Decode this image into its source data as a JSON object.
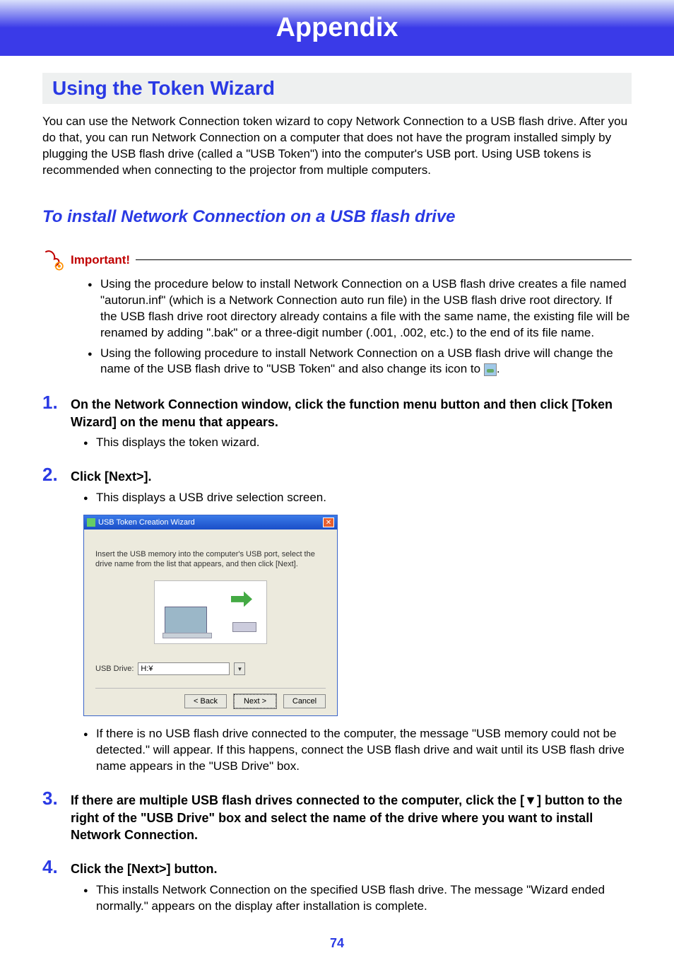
{
  "header": {
    "title": "Appendix"
  },
  "section": {
    "title": "Using the Token Wizard",
    "intro": "You can use the Network Connection token wizard to copy Network Connection to a USB flash drive. After you do that, you can run Network Connection on a computer that does not have the program installed simply by plugging the USB flash drive (called a \"USB Token\") into the computer's USB port. Using USB tokens is recommended when connecting to the projector from multiple computers."
  },
  "subsection": {
    "title": "To install Network Connection on a USB flash drive"
  },
  "important": {
    "label": "Important!",
    "items": [
      "Using the procedure below to install Network Connection on a USB flash drive creates a file named \"autorun.inf\" (which is a Network Connection auto run file) in the USB flash drive root directory. If the USB flash drive root directory already contains a file with the same name, the existing file will be renamed by adding \".bak\" or a three-digit number (.001, .002, etc.) to the end of its file name.",
      "Using the following procedure to install Network Connection on a USB flash drive will change the name of the USB flash drive to \"USB Token\" and also change its icon to "
    ],
    "trailing": "."
  },
  "steps": [
    {
      "num": "1.",
      "text": "On the Network Connection window, click the function menu button and then click [Token Wizard] on the menu that appears.",
      "sub": [
        "This displays the token wizard."
      ]
    },
    {
      "num": "2.",
      "text": "Click [Next>].",
      "sub": [
        "This displays a USB drive selection screen."
      ],
      "after": [
        "If there is no USB flash drive connected to the computer, the message \"USB memory could not be detected.\" will appear. If this happens, connect the USB flash drive and wait until its USB flash drive name appears in the \"USB Drive\" box."
      ]
    },
    {
      "num": "3.",
      "text": "If there are multiple USB flash drives connected to the computer, click the [▼] button to the right of the \"USB Drive\" box and select the name of the drive where you want to install Network Connection."
    },
    {
      "num": "4.",
      "text": "Click the [Next>] button.",
      "sub": [
        "This installs Network Connection on the specified USB flash drive. The message \"Wizard ended normally.\" appears on the display after installation is complete."
      ]
    }
  ],
  "wizard": {
    "title": "USB Token Creation Wizard",
    "instruction": "Insert the USB memory into the computer's USB port, select the drive name from the list that appears, and then click [Next].",
    "drive_label": "USB Drive:",
    "drive_value": "H:¥",
    "back": "< Back",
    "next": "Next >",
    "cancel": "Cancel"
  },
  "page_number": "74"
}
